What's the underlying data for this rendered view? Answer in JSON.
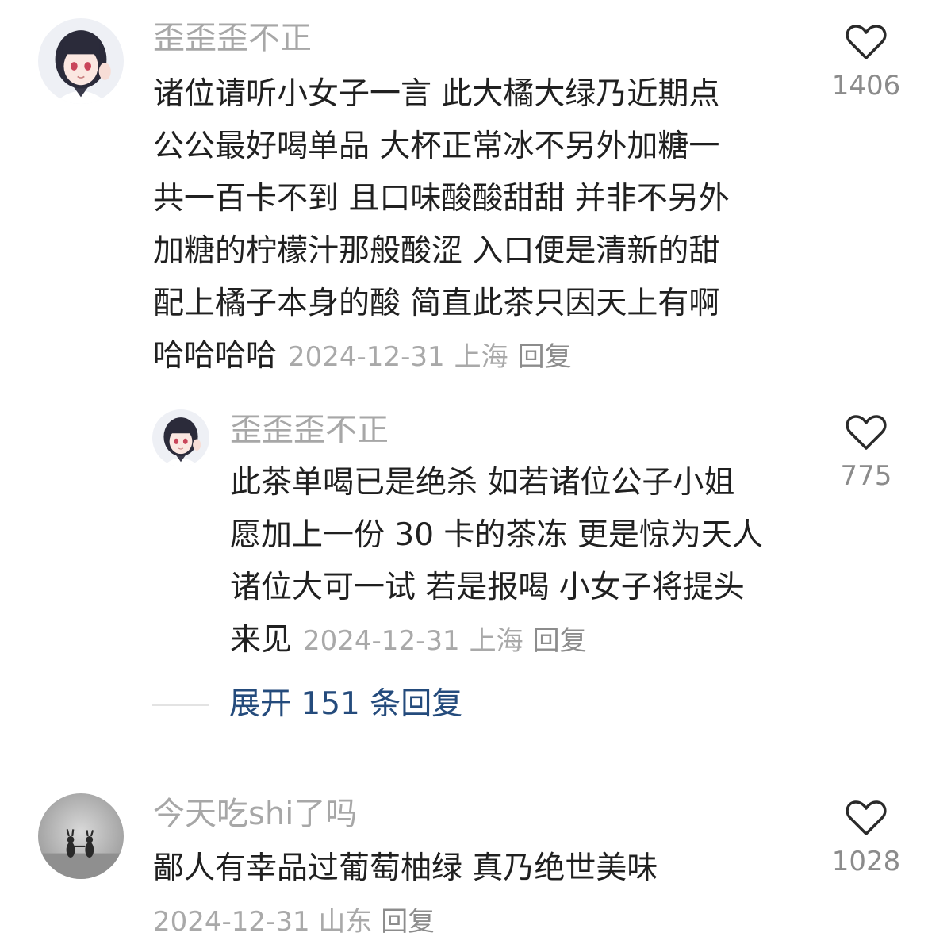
{
  "comments": [
    {
      "username": "歪歪歪不正",
      "avatar": "anime-girl-avatar",
      "lines": [
        "诸位请听小女子一言 此大橘大绿乃近期点",
        "公公最好喝单品 大杯正常冰不另外加糖一",
        "共一百卡不到 且口味酸酸甜甜 并非不另外",
        "加糖的柠檬汁那般酸涩 入口便是清新的甜",
        "配上橘子本身的酸 简直此茶只因天上有啊",
        "哈哈哈哈"
      ],
      "date": "2024-12-31",
      "location": "上海",
      "reply_label": "回复",
      "likes": "1406"
    },
    {
      "username": "歪歪歪不正",
      "avatar": "anime-girl-avatar",
      "lines": [
        "此茶单喝已是绝杀 如若诸位公子小姐",
        "愿加上一份 30 卡的茶冻 更是惊为天人",
        "诸位大可一试 若是报喝 小女子将提头",
        "来见"
      ],
      "date": "2024-12-31",
      "location": "上海",
      "reply_label": "回复",
      "likes": "775"
    },
    {
      "username": "今天吃shi了吗",
      "avatar": "grey-silhouette-avatar",
      "lines": [
        "鄙人有幸品过葡萄柚绿 真乃绝世美味"
      ],
      "date": "2024-12-31",
      "location": "山东",
      "reply_label": "回复",
      "likes": "1028"
    }
  ],
  "expand_replies": "展开 151 条回复",
  "icons": {
    "like": "heart-outline-icon"
  },
  "colors": {
    "username": "#a7a7a7",
    "meta": "#a9a9a9",
    "expand_link": "#244b7c",
    "like_icon": "#2a2a2a"
  }
}
